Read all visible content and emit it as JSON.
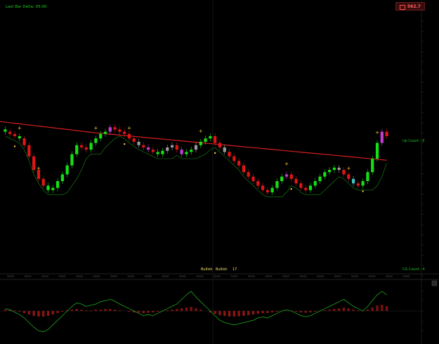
{
  "header": {
    "title": "Last Bar Delta: 05:00"
  },
  "price_badge": {
    "value": "562.7",
    "icon": "lock-icon",
    "bg": "#3a0d0d",
    "text_color": "#ff6060"
  },
  "right_labels": {
    "up_count": "Up Count : 8",
    "down_count": "CG Count : 4"
  },
  "legend": {
    "items": [
      "Bullish",
      "Bullish",
      "17"
    ]
  },
  "colors": {
    "background": "#000000",
    "bull": "#16e016",
    "bear": "#e01616",
    "neutral": "#9a9a9a",
    "teal": "#3ec2c2",
    "magenta": "#c040d0",
    "ma_line": "#d81e1e",
    "trail_line": "#1faa1f",
    "osc_line": "#1fa81f",
    "marker": "#ffcc33"
  },
  "chart_data": [
    {
      "type": "candlestick",
      "title": "",
      "x_count": 81,
      "ylim": [
        0,
        100
      ],
      "closes": [
        64,
        62,
        60,
        58,
        52,
        42,
        30,
        22,
        16,
        12,
        14,
        20,
        26,
        34,
        44,
        52,
        50,
        48,
        54,
        58,
        62,
        64,
        68,
        66,
        64,
        62,
        58,
        55,
        52,
        50,
        48,
        46,
        44,
        47,
        50,
        52,
        48,
        44,
        46,
        48,
        52,
        55,
        58,
        60,
        54,
        50,
        46,
        42,
        38,
        34,
        28,
        24,
        20,
        16,
        12,
        10,
        14,
        20,
        24,
        26,
        22,
        18,
        14,
        12,
        16,
        20,
        24,
        28,
        30,
        32,
        30,
        26,
        22,
        18,
        16,
        20,
        28,
        40,
        54,
        64,
        60
      ],
      "colors": [
        "g",
        "r",
        "r",
        "g",
        "r",
        "r",
        "r",
        "r",
        "r",
        "g",
        "g",
        "g",
        "g",
        "g",
        "g",
        "g",
        "r",
        "r",
        "g",
        "g",
        "g",
        "g",
        "m",
        "r",
        "r",
        "r",
        "r",
        "r",
        "n",
        "r",
        "m",
        "r",
        "g",
        "g",
        "n",
        "n",
        "r",
        "m",
        "g",
        "g",
        "n",
        "g",
        "g",
        "g",
        "r",
        "r",
        "n",
        "r",
        "r",
        "r",
        "r",
        "r",
        "r",
        "r",
        "r",
        "r",
        "g",
        "g",
        "g",
        "m",
        "r",
        "r",
        "r",
        "r",
        "g",
        "g",
        "g",
        "g",
        "g",
        "g",
        "n",
        "r",
        "r",
        "t",
        "r",
        "g",
        "g",
        "g",
        "g",
        "m",
        "r"
      ],
      "ma_line": [
        73,
        72,
        71.5,
        71,
        70.5,
        70,
        69.5,
        69,
        68.5,
        68,
        67.5,
        67,
        66.5,
        66,
        65.5,
        65,
        64.5,
        64,
        63.5,
        63,
        62.6,
        62.2,
        61.8,
        61.4,
        61,
        60.6,
        60.2,
        59.8,
        59.4,
        59,
        58.6,
        58.2,
        57.8,
        57.4,
        57,
        56.6,
        56.2,
        55.8,
        55.4,
        55,
        54.6,
        54.2,
        53.8,
        53.4,
        53,
        52.6,
        52.2,
        51.8,
        51.4,
        51,
        50.6,
        50.2,
        49.8,
        49.4,
        49,
        48.6,
        48.2,
        47.8,
        47.4,
        47,
        46.6,
        46.2,
        45.8,
        45.4,
        45,
        44.6,
        44.2,
        43.8,
        43.4,
        43,
        42.6,
        42.2,
        41.8,
        41.4,
        41,
        40.6,
        40.2,
        39.8,
        39.4,
        39,
        38.6
      ],
      "markers_up": [
        3,
        7,
        19,
        26,
        41,
        59,
        72,
        78
      ],
      "markers_down": [
        2,
        25,
        44,
        60,
        75
      ]
    },
    {
      "type": "oscillator",
      "title": "",
      "ylim": [
        -1,
        1
      ],
      "values": [
        0.1,
        0.05,
        -0.05,
        -0.15,
        -0.3,
        -0.5,
        -0.7,
        -0.85,
        -0.9,
        -0.8,
        -0.6,
        -0.4,
        -0.2,
        0.0,
        0.2,
        0.35,
        0.3,
        0.2,
        0.25,
        0.3,
        0.4,
        0.45,
        0.5,
        0.42,
        0.3,
        0.2,
        0.1,
        0.0,
        -0.1,
        -0.2,
        -0.15,
        -0.2,
        -0.1,
        0.0,
        0.1,
        0.2,
        0.3,
        0.5,
        0.7,
        0.85,
        0.6,
        0.4,
        0.2,
        0.0,
        -0.2,
        -0.4,
        -0.5,
        -0.55,
        -0.6,
        -0.55,
        -0.5,
        -0.45,
        -0.4,
        -0.3,
        -0.25,
        -0.3,
        -0.2,
        -0.1,
        0.0,
        0.05,
        0.0,
        -0.1,
        -0.2,
        -0.25,
        -0.2,
        -0.1,
        0.0,
        0.1,
        0.2,
        0.3,
        0.4,
        0.5,
        0.35,
        0.2,
        0.1,
        0.0,
        0.2,
        0.45,
        0.7,
        0.85,
        0.7
      ],
      "histogram": [
        0.1,
        0.1,
        0.05,
        -0.05,
        -0.15,
        -0.25,
        -0.35,
        -0.4,
        -0.4,
        -0.35,
        -0.25,
        -0.15,
        -0.05,
        0.05,
        0.1,
        0.15,
        0.1,
        0.05,
        0.05,
        0.1,
        0.1,
        0.15,
        0.15,
        0.1,
        0.05,
        0.0,
        -0.05,
        -0.1,
        -0.12,
        -0.15,
        -0.12,
        -0.1,
        -0.05,
        0.0,
        0.05,
        0.1,
        0.15,
        0.2,
        0.25,
        0.3,
        0.2,
        0.1,
        0.0,
        -0.1,
        -0.2,
        -0.3,
        -0.35,
        -0.4,
        -0.4,
        -0.38,
        -0.35,
        -0.3,
        -0.25,
        -0.2,
        -0.15,
        -0.15,
        -0.1,
        -0.05,
        0.0,
        0.02,
        0.0,
        -0.05,
        -0.1,
        -0.12,
        -0.1,
        -0.05,
        0.0,
        0.05,
        0.1,
        0.15,
        0.2,
        0.25,
        0.2,
        0.1,
        0.05,
        0.0,
        0.1,
        0.25,
        0.4,
        0.45,
        0.35
      ]
    }
  ]
}
